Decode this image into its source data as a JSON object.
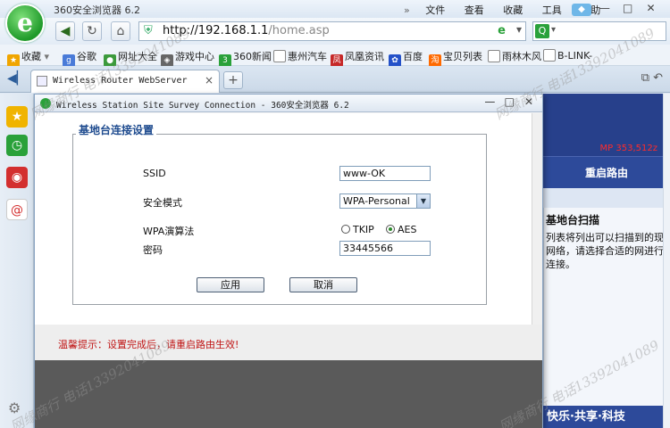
{
  "browser": {
    "app_title": "360安全浏览器 6.2",
    "logo_letter": "e",
    "menu": {
      "chevron": "»",
      "items": [
        "文件",
        "查看",
        "收藏",
        "工具",
        "帮助"
      ]
    },
    "window_controls": {
      "minimize": "—",
      "maximize": "□",
      "close": "✕"
    },
    "address": {
      "prefix": "http://192.168.1.1",
      "path": "/home.asp"
    },
    "search": {
      "value": ""
    },
    "bookmarks": [
      {
        "label": "收藏",
        "icon": "star-icon",
        "color": "#f0a500"
      },
      {
        "label": "谷歌",
        "icon": "google-icon",
        "color": "#4a7bd8"
      },
      {
        "label": "网址大全",
        "icon": "globe-icon",
        "color": "#3c9a3c"
      },
      {
        "label": "游戏中心",
        "icon": "gamepad-icon",
        "color": "#666666"
      },
      {
        "label": "360新闻",
        "icon": "news-360-icon",
        "color": "#2aa13a"
      },
      {
        "label": "惠州汽车",
        "icon": "page-icon",
        "color": "#777777"
      },
      {
        "label": "凤凰资讯",
        "icon": "phoenix-icon",
        "color": "#c62828"
      },
      {
        "label": "百度",
        "icon": "baidu-paw-icon",
        "color": "#2451c8"
      },
      {
        "label": "宝贝列表",
        "icon": "taobao-icon",
        "color": "#ff6a00"
      },
      {
        "label": "雨林木风",
        "icon": "page-icon",
        "color": "#777777"
      },
      {
        "label": "B-LINK-",
        "icon": "page-icon",
        "color": "#777777"
      }
    ],
    "tab": {
      "title": "Wireless Router WebServer",
      "close": "×",
      "new": "+"
    }
  },
  "background_page": {
    "red_status": "MP 353,512z",
    "reboot_label": "重启路由",
    "help_title": "基地台扫描",
    "help_text": "列表将列出可以扫描到的现网络，请选择合适的网进行连接。",
    "bottom_slogan": "快乐·共享·科技"
  },
  "popup": {
    "title": "Wireless Station Site Survey Connection - 360安全浏览器 6.2",
    "legend": "基地台连接设置",
    "fields": {
      "ssid_label": "SSID",
      "ssid_value": "www-OK",
      "security_label": "安全模式",
      "security_value": "WPA-Personal",
      "wpa_label": "WPA演算法",
      "wpa_options": [
        "TKIP",
        "AES"
      ],
      "wpa_selected": "AES",
      "password_label": "密码",
      "password_value": "33445566"
    },
    "apply_label": "应用",
    "cancel_label": "取消",
    "warning": "温馨提示：设置完成后，请重启路由生效!"
  },
  "watermarks": [
    "网缘商行 电话13392041089",
    "网缘商行 电话13392041089",
    "网缘商行 电话13392041089",
    "网缘商行 电话13392041089"
  ]
}
